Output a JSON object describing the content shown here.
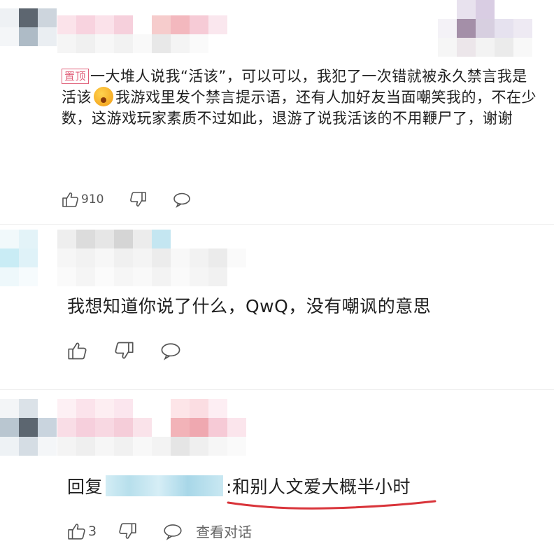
{
  "comment1": {
    "pinned_badge": "置顶",
    "text_before_emoji": "一大堆人说我“活该”，可以可以，我犯了一次错就被永久禁言我是活该",
    "emoji": "angry-face-emoji",
    "text_after_emoji": "我游戏里发个禁言提示语，还有人加好友当面嘲笑我的，不在少数，这游戏玩家素质不过如此，退游了说我活该的不用鞭尸了，谢谢",
    "likes": "910"
  },
  "comment2": {
    "text": "我想知道你说了什么，QwQ，没有嘲讽的意思"
  },
  "comment3": {
    "reply_prefix": "回复",
    "reply_text": ":和别人文爱大概半小时",
    "likes": "3",
    "view_conversation": "查看对话"
  },
  "colors": {
    "pinned": "#e0607a",
    "underline": "#d9343a",
    "icon": "#555555"
  }
}
